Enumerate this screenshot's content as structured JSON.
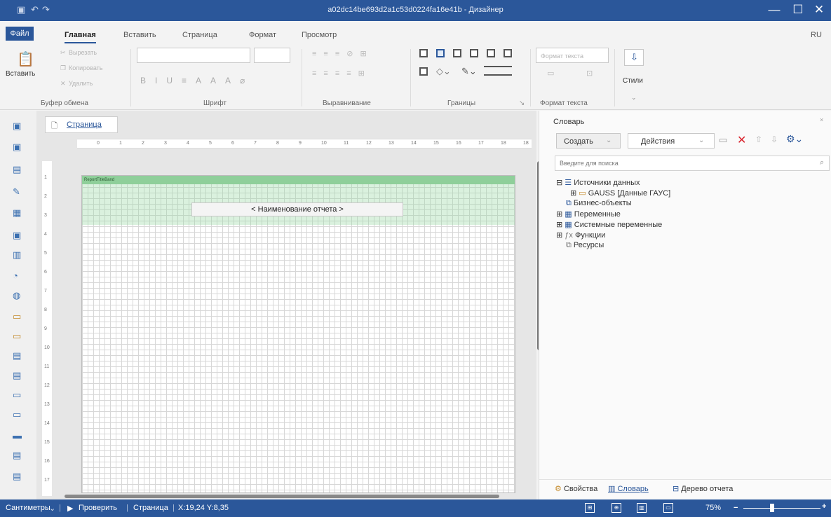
{
  "titlebar": {
    "title": "a02dc14be693d2a1c53d0224fa16e41b - Дизайнер",
    "minimize": "—",
    "maximize": "☐",
    "close": "✕"
  },
  "tabs": {
    "file": "Файл",
    "home": "Главная",
    "insert": "Вставить",
    "page": "Страница",
    "format": "Формат",
    "view": "Просмотр",
    "lang": "RU"
  },
  "ribbon": {
    "paste": "Вставить",
    "cut": "Вырезать",
    "copy": "Копировать",
    "delete": "Удалить",
    "clipboard_group": "Буфер обмена",
    "font_group": "Шрифт",
    "align_group": "Выравнивание",
    "borders_group": "Границы",
    "text_format_btn": "Формат текста",
    "text_format_group": "Формат текста",
    "styles": "Стили"
  },
  "designer": {
    "page_tab": "Страница",
    "band_name": "ReportTitleBand",
    "report_title": "< Наименование отчета >",
    "ruler_marks": [
      "0",
      "1",
      "2",
      "3",
      "4",
      "5",
      "6",
      "7",
      "8",
      "9",
      "10",
      "11",
      "12",
      "13",
      "14",
      "15",
      "16",
      "17",
      "18",
      "18"
    ],
    "vruler_marks": [
      "1",
      "2",
      "3",
      "4",
      "5",
      "6",
      "7",
      "8",
      "9",
      "10",
      "11",
      "12",
      "13",
      "14",
      "15",
      "16",
      "17"
    ]
  },
  "dictionary": {
    "title": "Словарь",
    "create": "Создать",
    "actions": "Действия",
    "search_placeholder": "Введите для поиска",
    "tree": {
      "data_sources": "Источники данных",
      "gauss": "GAUSS [Данные ГАУС]",
      "business_objects": "Бизнес-объекты",
      "variables": "Переменные",
      "system_variables": "Системные переменные",
      "functions": "Функции",
      "resources": "Ресурсы"
    },
    "bottom_tabs": {
      "properties": "Свойства",
      "dictionary": "Словарь",
      "report_tree": "Дерево отчета"
    }
  },
  "statusbar": {
    "units": "Сантиметры",
    "check": "Проверить",
    "page": "Страница",
    "coords": "X:19,24 Y:8,35",
    "zoom": "75%"
  },
  "colors": {
    "accent": "#2b579a",
    "band": "#8fcf9a",
    "delete_red": "#d9232d"
  }
}
